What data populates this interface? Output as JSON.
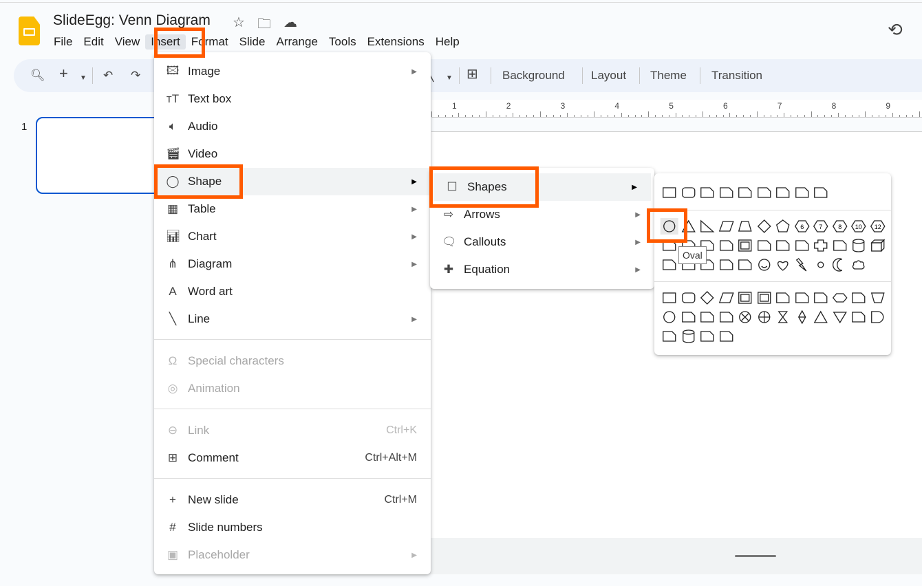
{
  "app": {
    "title": "SlideEgg: Venn Diagram",
    "icons": [
      "star-icon",
      "move-to-folder-icon",
      "cloud-saved-icon"
    ]
  },
  "menubar": [
    "File",
    "Edit",
    "View",
    "Insert",
    "Format",
    "Slide",
    "Arrange",
    "Tools",
    "Extensions",
    "Help"
  ],
  "menubar_active": "Insert",
  "toolbar": {
    "background": "Background",
    "layout": "Layout",
    "theme": "Theme",
    "transition": "Transition"
  },
  "ruler": [
    "1",
    "2",
    "3",
    "4",
    "5",
    "6",
    "7",
    "8",
    "9"
  ],
  "filmstrip": {
    "slide_number": "1"
  },
  "insert_menu": {
    "items": [
      {
        "label": "Image",
        "icon": "image-icon",
        "submenu": true
      },
      {
        "label": "Text box",
        "icon": "text-box-icon"
      },
      {
        "label": "Audio",
        "icon": "audio-icon"
      },
      {
        "label": "Video",
        "icon": "video-icon"
      },
      {
        "label": "Shape",
        "icon": "shape-icon",
        "submenu": true,
        "highlighted": true
      },
      {
        "label": "Table",
        "icon": "table-icon",
        "submenu": true
      },
      {
        "label": "Chart",
        "icon": "chart-icon",
        "submenu": true
      },
      {
        "label": "Diagram",
        "icon": "diagram-icon",
        "submenu": true
      },
      {
        "label": "Word art",
        "icon": "word-art-icon"
      },
      {
        "label": "Line",
        "icon": "line-icon",
        "submenu": true
      },
      {
        "label": "Special characters",
        "icon": "omega-icon",
        "disabled": true
      },
      {
        "label": "Animation",
        "icon": "animation-icon",
        "disabled": true
      },
      {
        "label": "Link",
        "icon": "link-icon",
        "shortcut": "Ctrl+K",
        "disabled": true
      },
      {
        "label": "Comment",
        "icon": "comment-icon",
        "shortcut": "Ctrl+Alt+M"
      },
      {
        "label": "New slide",
        "icon": "plus-icon",
        "shortcut": "Ctrl+M"
      },
      {
        "label": "Slide numbers",
        "icon": "hash-icon"
      },
      {
        "label": "Placeholder",
        "icon": "placeholder-icon",
        "submenu": true,
        "disabled": true
      }
    ]
  },
  "shape_submenu": {
    "items": [
      {
        "label": "Shapes",
        "icon": "square-icon",
        "highlighted": true
      },
      {
        "label": "Arrows",
        "icon": "arrow-icon"
      },
      {
        "label": "Callouts",
        "icon": "callout-icon"
      },
      {
        "label": "Equation",
        "icon": "equation-plus-icon"
      }
    ]
  },
  "shapes_panel": {
    "rows": [
      [
        "rect",
        "round",
        "snip1",
        "snip2",
        "snipd",
        "rsnip",
        "snipr",
        "round2",
        "rounddiag"
      ],
      [
        "oval",
        "tri",
        "rtri",
        "para",
        "trap",
        "diamond",
        "pent",
        "6",
        "7",
        "8",
        "10",
        "12"
      ],
      [
        "pie",
        "chord",
        "tear",
        "teardrop",
        "frame",
        "halfframe",
        "lshape",
        "diagstripe",
        "plus",
        "plaque",
        "can",
        "cube"
      ],
      [
        "bevel",
        "donut",
        "nosym",
        "arc",
        "folded",
        "smiley",
        "heart",
        "bolt",
        "sun",
        "moon",
        "cloud"
      ],
      [
        "rect",
        "round",
        "diamond",
        "para",
        "frame",
        "frame",
        "doc",
        "multidoc",
        "term",
        "hex",
        "manual",
        "trapinv"
      ],
      [
        "oval",
        "offpage",
        "card",
        "tape",
        "sumjunction",
        "or",
        "collate",
        "sort",
        "tri",
        "merge",
        "stored",
        "delay"
      ],
      [
        "seqaccess",
        "can",
        "drum",
        "display"
      ]
    ],
    "tooltip": "Oval",
    "selected": "oval"
  },
  "colors": {
    "accent": "#0b57d0",
    "highlight_box": "#ff5a00",
    "logo": "#fbbc04"
  }
}
